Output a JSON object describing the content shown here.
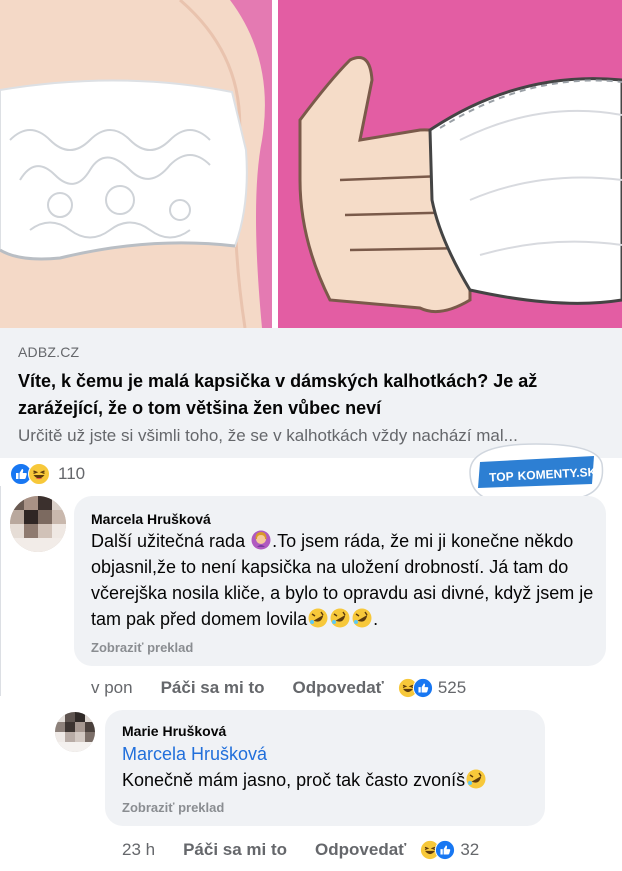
{
  "link_preview": {
    "domain": "ADBZ.CZ",
    "title": "Víte, k čemu je malá kapsička v dámských kalhotkách? Je až zarážející, že o tom většina žen vůbec neví",
    "description": "Určitě už jste si všimli toho, že se v kalhotkách vždy nachází mal..."
  },
  "post_reactions": {
    "icons": [
      "like-icon",
      "haha-icon"
    ],
    "count": "110"
  },
  "badge": {
    "text_top": "TOP",
    "text_brand": "KOMENTY.SK",
    "color": "#2d7fd3"
  },
  "comments": [
    {
      "author": "Marcela Hrušková",
      "text_part1": "Další užitečná rada",
      "text_part2": ".To jsem ráda, že mi ji konečne někdo objasnil,že to není kapsička na uložení drobností. Já tam do včerejška nosila kliče, a bylo to opravdu asi divné, když jsem je tam pak před domem lovila",
      "text_end": ".",
      "translate": "Zobraziť preklad",
      "time": "v pon",
      "like_label": "Páči sa mi to",
      "reply_label": "Odpovedať",
      "reaction_count": "525"
    },
    {
      "author": "Marie Hrušková",
      "mention": "Marcela Hrušková",
      "text": "Konečně mám jasno, proč tak často zvoníš",
      "translate": "Zobraziť preklad",
      "time": "23 h",
      "like_label": "Páči sa mi to",
      "reply_label": "Odpovedať",
      "reaction_count": "32"
    }
  ],
  "colors": {
    "facebook_blue": "#1877f2",
    "bubble_bg": "#f0f2f5",
    "mention": "#216fdb",
    "pink_bg": "#e05fa0"
  }
}
